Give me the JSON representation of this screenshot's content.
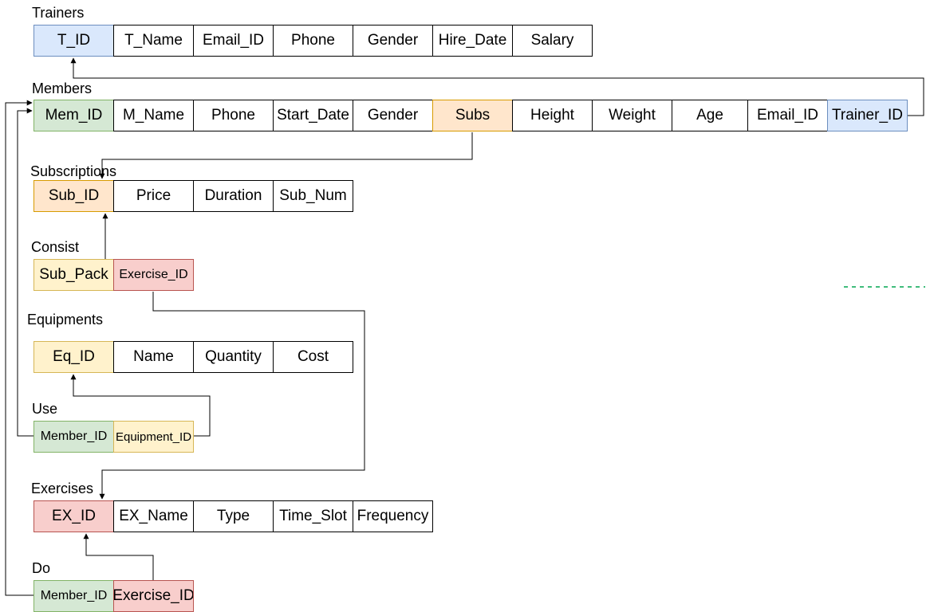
{
  "tables": {
    "trainers": {
      "title": "Trainers",
      "cols": [
        "T_ID",
        "T_Name",
        "Email_ID",
        "Phone",
        "Gender",
        "Hire_Date",
        "Salary"
      ]
    },
    "members": {
      "title": "Members",
      "cols": [
        "Mem_ID",
        "M_Name",
        "Phone",
        "Start_Date",
        "Gender",
        "Subs",
        "Height",
        "Weight",
        "Age",
        "Email_ID",
        "Trainer_ID"
      ]
    },
    "subscriptions": {
      "title": "Subscriptions",
      "cols": [
        "Sub_ID",
        "Price",
        "Duration",
        "Sub_Num"
      ]
    },
    "consist": {
      "title": "Consist",
      "cols": [
        "Sub_Pack",
        "Exercise_ID"
      ]
    },
    "equipments": {
      "title": "Equipments",
      "cols": [
        "Eq_ID",
        "Name",
        "Quantity",
        "Cost"
      ]
    },
    "use": {
      "title": "Use",
      "cols": [
        "Member_ID",
        "Equipment_ID"
      ]
    },
    "exercises": {
      "title": "Exercises",
      "cols": [
        "EX_ID",
        "EX_Name",
        "Type",
        "Time_Slot",
        "Frequency"
      ]
    },
    "do": {
      "title": "Do",
      "cols": [
        "Member_ID",
        "Exercise_ID"
      ]
    }
  },
  "colors": {
    "blue_fill": "#dae8fc",
    "green_fill": "#d5e8d4",
    "orange_fill": "#ffe6cc",
    "yellow_fill": "#fff2cc",
    "red_fill": "#f8cecc",
    "dashed_line": "#00a651"
  }
}
